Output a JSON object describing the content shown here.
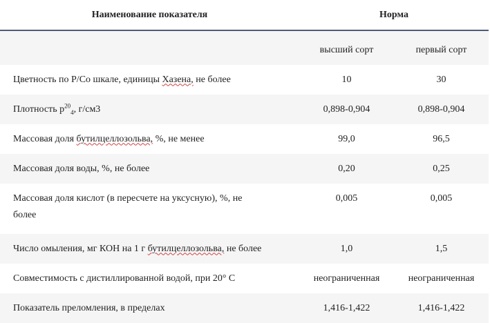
{
  "header": {
    "col_name": "Наименование показателя",
    "col_norm": "Норма"
  },
  "subheader": {
    "grade_top": "высший сорт",
    "grade_first": "первый сорт"
  },
  "rows": [
    {
      "name_pre": "Цветность по Р/Со шкале, единицы ",
      "name_squig": "Хазена,",
      "name_post": " не более",
      "top": "10",
      "first": "30"
    },
    {
      "name_pre": "Плотность р",
      "sup": "20",
      "sub": "4",
      "name_post": ", г/см3",
      "top": "0,898-0,904",
      "first": "0,898-0,904"
    },
    {
      "name_pre": "Массовая доля ",
      "name_squig": "бутилцеллозольва,",
      "name_post": " %, не менее",
      "top": "99,0",
      "first": "96,5"
    },
    {
      "name": "Массовая доля воды, %, не более",
      "top": "0,20",
      "first": "0,25"
    },
    {
      "name_line1": "Массовая доля кислот (в пересчете на уксусную), %, не",
      "name_line2": "более",
      "top": "0,005",
      "first": "0,005"
    },
    {
      "name_pre": "Число омыления, мг КОН на 1 г ",
      "name_squig": "бутилцеллозольва,",
      "name_post": " не более",
      "top": "1,0",
      "first": "1,5"
    },
    {
      "name": "Совместимость с дистиллированной водой, при 20° С",
      "top": "неограниченная",
      "first": "неограниченная"
    },
    {
      "name": "Показатель преломления, в пределах",
      "top": "1,416-1,422",
      "first": "1,416-1,422"
    }
  ]
}
